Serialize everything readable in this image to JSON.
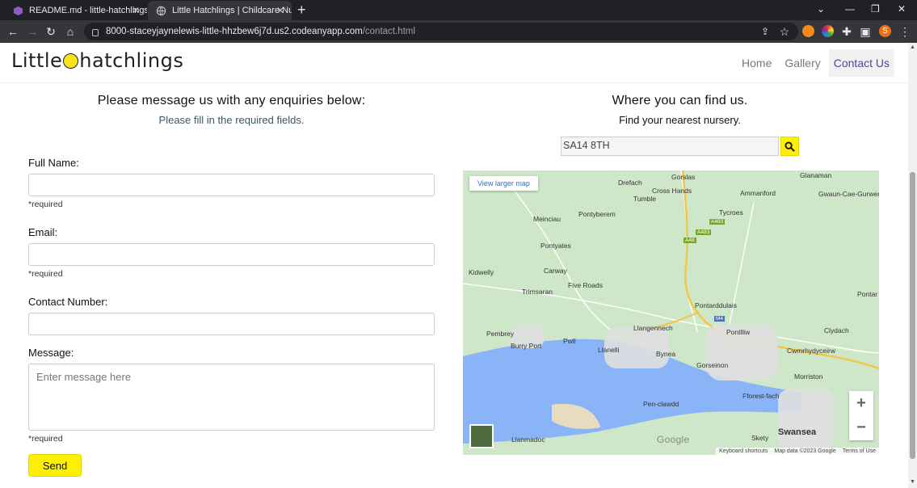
{
  "browser": {
    "tabs": [
      {
        "title": "README.md - little-hatchlings - G"
      },
      {
        "title": "Little Hatchlings | Childcare Nurs"
      }
    ],
    "url_host": "8000-staceyjaynelewis-little-hhzbew6j7d.us2.codeanyapp.com",
    "url_path": "/contact.html",
    "profile_initial": "S"
  },
  "site": {
    "logo_left": "Little",
    "logo_right": "hatchlings",
    "nav": [
      {
        "label": "Home"
      },
      {
        "label": "Gallery"
      },
      {
        "label": "Contact Us"
      }
    ]
  },
  "form": {
    "heading": "Please message us with any enquiries below:",
    "subheading": "Please fill in the required fields.",
    "full_name_label": "Full Name:",
    "email_label": "Email:",
    "contact_label": "Contact Number:",
    "message_label": "Message:",
    "message_placeholder": "Enter message here",
    "required_note": "*required",
    "send_label": "Send"
  },
  "finder": {
    "heading": "Where you can find us.",
    "subheading": "Find your nearest nursery.",
    "search_value": "SA14 8TH"
  },
  "map": {
    "view_larger": "View larger map",
    "places": [
      "Gorslas",
      "Glanaman",
      "Drefach",
      "Cross Hands",
      "Ammanford",
      "Gwaun-Cae-Gurwen",
      "Tumble",
      "Tycroes",
      "Meinciau",
      "Pontyberem",
      "Pontyates",
      "Kidwelly",
      "Carway",
      "Trimsaran",
      "Five Roads",
      "Pontarddulais",
      "Pontar",
      "Llangennech",
      "Pontlliw",
      "Clydach",
      "Pembrey",
      "Burry Port",
      "Pwll",
      "Llanelli",
      "Bynea",
      "Cwmrhydyceirw",
      "Gorseinon",
      "Morriston",
      "Fforest-fach",
      "Pen-clawdd",
      "Llanmadoc",
      "Skety",
      "Swansea"
    ],
    "roads": [
      "A483",
      "A483",
      "A48",
      "M4"
    ],
    "google": "Google",
    "attribution": [
      "Keyboard shortcuts",
      "Map data ©2023 Google",
      "Terms of Use"
    ]
  },
  "colors": {
    "accent": "#ffef00",
    "nav_active": "#5a3fa0"
  }
}
